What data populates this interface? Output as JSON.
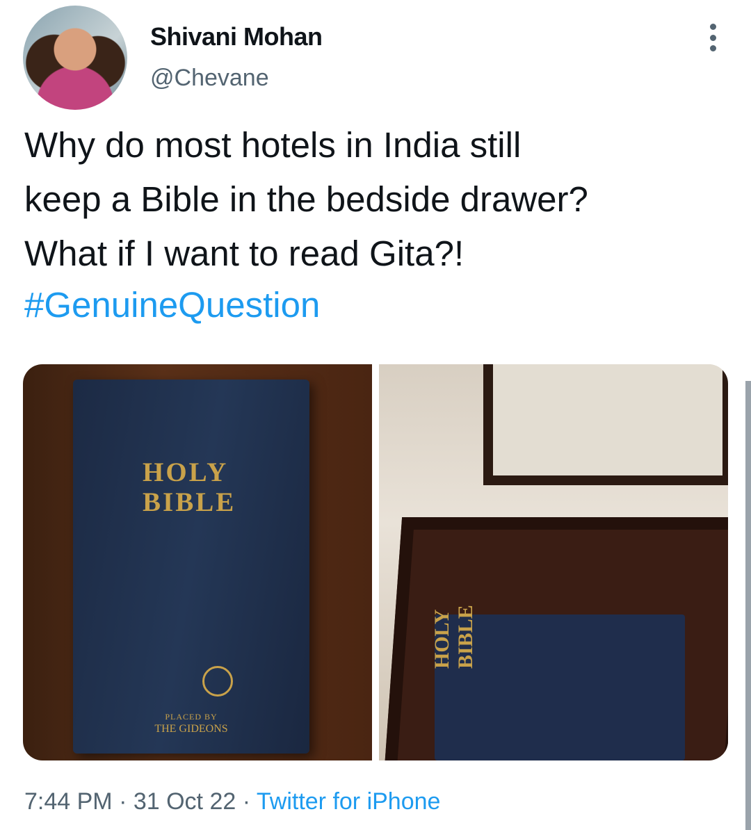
{
  "author": {
    "name": "Shivani Mohan",
    "handle": "@Chevane"
  },
  "tweet": {
    "text": "Why do most hotels in India still\nkeep a Bible in the bedside drawer?\nWhat if I want to read Gita?!",
    "hashtag": "#GenuineQuestion"
  },
  "media": {
    "left": {
      "title": "HOLY\nBIBLE",
      "placed_by": "PLACED BY",
      "publisher": "THE GIDEONS"
    },
    "right": {
      "title": "HOLY\nBIBLE"
    }
  },
  "meta": {
    "time": "7:44 PM",
    "separator": " · ",
    "date": "31 Oct 22",
    "source": "Twitter for iPhone"
  },
  "icons": {
    "more": "more-vertical-icon"
  },
  "colors": {
    "link": "#1d9bf0",
    "secondary": "#536471"
  }
}
